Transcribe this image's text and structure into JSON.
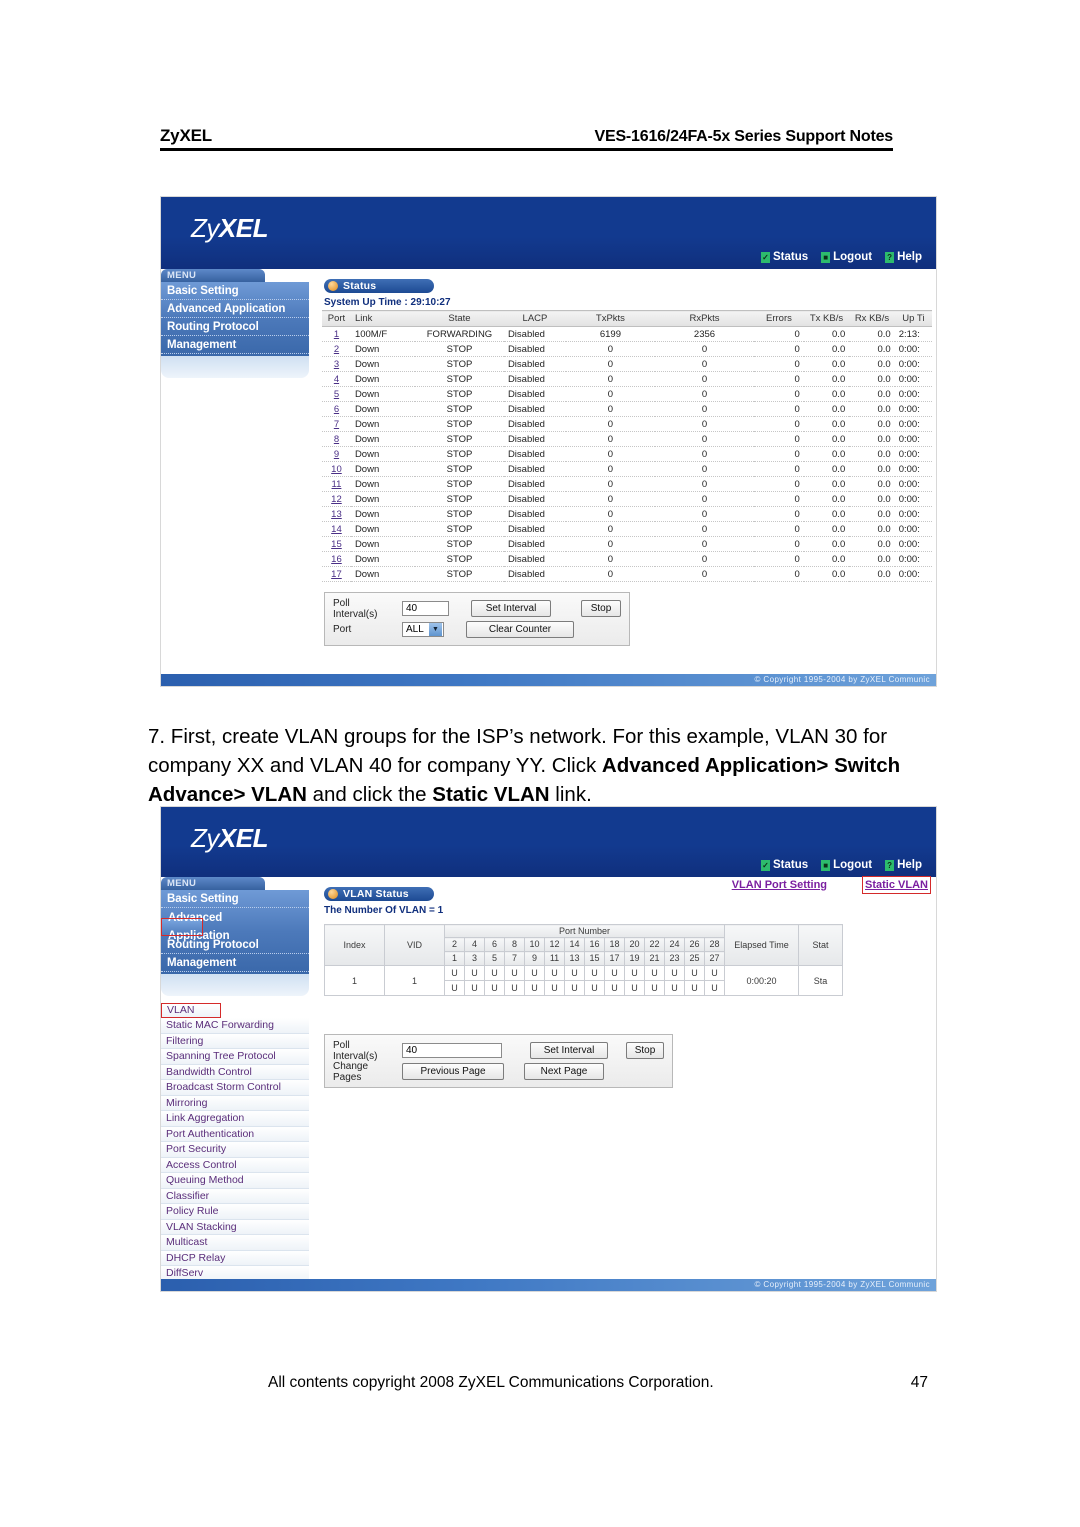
{
  "page": {
    "header": {
      "brand": "ZyXEL",
      "doc_title": "VES-1616/24FA-5x Series Support Notes"
    },
    "footer": {
      "copyright": "All contents copyright 2008 ZyXEL Communications Corporation.",
      "page_number": "47"
    },
    "instruction": {
      "part1": "7. First, create VLAN groups for the ISP’s network. For this example, VLAN 30 for company XX and VLAN 40 for company YY. Click ",
      "bold1": "Advanced Application> Switch Advance> VLAN",
      "part2": " and click the ",
      "bold2": "Static VLAN",
      "part3": " link."
    }
  },
  "device_ui": {
    "logo_prefix": "Zy",
    "logo_suffix": "XEL",
    "banner_links": [
      {
        "label": "Status",
        "glyph": "✓"
      },
      {
        "label": "Logout",
        "glyph": "■"
      },
      {
        "label": "Help",
        "glyph": "?"
      }
    ],
    "copyright_bar": "© Copyright 1995-2004 by ZyXEL Communic",
    "menu_tab_label": "MENU",
    "main_menu": [
      {
        "label": "Basic Setting",
        "selected": false
      },
      {
        "label": "Advanced Application",
        "selected": false
      },
      {
        "label": "Routing Protocol",
        "selected": false
      },
      {
        "label": "Management",
        "selected": false
      }
    ],
    "main_menu_2": [
      {
        "label": "Basic Setting",
        "selected": false
      },
      {
        "label": "Advanced Application",
        "selected": true
      },
      {
        "label": "Routing Protocol",
        "selected": false
      },
      {
        "label": "Management",
        "selected": false
      }
    ],
    "sub_menu": [
      {
        "label": "VLAN",
        "selected": true
      },
      {
        "label": "Static MAC Forwarding",
        "selected": false
      },
      {
        "label": "Filtering",
        "selected": false
      },
      {
        "label": "Spanning Tree Protocol",
        "selected": false
      },
      {
        "label": "Bandwidth Control",
        "selected": false
      },
      {
        "label": "Broadcast Storm Control",
        "selected": false
      },
      {
        "label": "Mirroring",
        "selected": false
      },
      {
        "label": "Link Aggregation",
        "selected": false
      },
      {
        "label": "Port Authentication",
        "selected": false
      },
      {
        "label": "Port Security",
        "selected": false
      },
      {
        "label": "Access Control",
        "selected": false
      },
      {
        "label": "Queuing Method",
        "selected": false
      },
      {
        "label": "Classifier",
        "selected": false
      },
      {
        "label": "Policy Rule",
        "selected": false
      },
      {
        "label": "VLAN Stacking",
        "selected": false
      },
      {
        "label": "Multicast",
        "selected": false
      },
      {
        "label": "DHCP Relay",
        "selected": false
      },
      {
        "label": "DiffServ",
        "selected": false
      }
    ]
  },
  "status_screen": {
    "panel_title": "Status",
    "system_up_time_label": "System Up Time : 29:10:27",
    "columns": [
      "Port",
      "Link",
      "State",
      "LACP",
      "TxPkts",
      "RxPkts",
      "Errors",
      "Tx KB/s",
      "Rx KB/s",
      "Up Ti"
    ],
    "rows": [
      {
        "port": "1",
        "link": "100M/F",
        "state": "FORWARDING",
        "lacp": "Disabled",
        "txpkts": "6199",
        "rxpkts": "2356",
        "errors": "0",
        "txkbs": "0.0",
        "rxkbs": "0.0",
        "uptime": "2:13:"
      },
      {
        "port": "2",
        "link": "Down",
        "state": "STOP",
        "lacp": "Disabled",
        "txpkts": "0",
        "rxpkts": "0",
        "errors": "0",
        "txkbs": "0.0",
        "rxkbs": "0.0",
        "uptime": "0:00:"
      },
      {
        "port": "3",
        "link": "Down",
        "state": "STOP",
        "lacp": "Disabled",
        "txpkts": "0",
        "rxpkts": "0",
        "errors": "0",
        "txkbs": "0.0",
        "rxkbs": "0.0",
        "uptime": "0:00:"
      },
      {
        "port": "4",
        "link": "Down",
        "state": "STOP",
        "lacp": "Disabled",
        "txpkts": "0",
        "rxpkts": "0",
        "errors": "0",
        "txkbs": "0.0",
        "rxkbs": "0.0",
        "uptime": "0:00:"
      },
      {
        "port": "5",
        "link": "Down",
        "state": "STOP",
        "lacp": "Disabled",
        "txpkts": "0",
        "rxpkts": "0",
        "errors": "0",
        "txkbs": "0.0",
        "rxkbs": "0.0",
        "uptime": "0:00:"
      },
      {
        "port": "6",
        "link": "Down",
        "state": "STOP",
        "lacp": "Disabled",
        "txpkts": "0",
        "rxpkts": "0",
        "errors": "0",
        "txkbs": "0.0",
        "rxkbs": "0.0",
        "uptime": "0:00:"
      },
      {
        "port": "7",
        "link": "Down",
        "state": "STOP",
        "lacp": "Disabled",
        "txpkts": "0",
        "rxpkts": "0",
        "errors": "0",
        "txkbs": "0.0",
        "rxkbs": "0.0",
        "uptime": "0:00:"
      },
      {
        "port": "8",
        "link": "Down",
        "state": "STOP",
        "lacp": "Disabled",
        "txpkts": "0",
        "rxpkts": "0",
        "errors": "0",
        "txkbs": "0.0",
        "rxkbs": "0.0",
        "uptime": "0:00:"
      },
      {
        "port": "9",
        "link": "Down",
        "state": "STOP",
        "lacp": "Disabled",
        "txpkts": "0",
        "rxpkts": "0",
        "errors": "0",
        "txkbs": "0.0",
        "rxkbs": "0.0",
        "uptime": "0:00:"
      },
      {
        "port": "10",
        "link": "Down",
        "state": "STOP",
        "lacp": "Disabled",
        "txpkts": "0",
        "rxpkts": "0",
        "errors": "0",
        "txkbs": "0.0",
        "rxkbs": "0.0",
        "uptime": "0:00:"
      },
      {
        "port": "11",
        "link": "Down",
        "state": "STOP",
        "lacp": "Disabled",
        "txpkts": "0",
        "rxpkts": "0",
        "errors": "0",
        "txkbs": "0.0",
        "rxkbs": "0.0",
        "uptime": "0:00:"
      },
      {
        "port": "12",
        "link": "Down",
        "state": "STOP",
        "lacp": "Disabled",
        "txpkts": "0",
        "rxpkts": "0",
        "errors": "0",
        "txkbs": "0.0",
        "rxkbs": "0.0",
        "uptime": "0:00:"
      },
      {
        "port": "13",
        "link": "Down",
        "state": "STOP",
        "lacp": "Disabled",
        "txpkts": "0",
        "rxpkts": "0",
        "errors": "0",
        "txkbs": "0.0",
        "rxkbs": "0.0",
        "uptime": "0:00:"
      },
      {
        "port": "14",
        "link": "Down",
        "state": "STOP",
        "lacp": "Disabled",
        "txpkts": "0",
        "rxpkts": "0",
        "errors": "0",
        "txkbs": "0.0",
        "rxkbs": "0.0",
        "uptime": "0:00:"
      },
      {
        "port": "15",
        "link": "Down",
        "state": "STOP",
        "lacp": "Disabled",
        "txpkts": "0",
        "rxpkts": "0",
        "errors": "0",
        "txkbs": "0.0",
        "rxkbs": "0.0",
        "uptime": "0:00:"
      },
      {
        "port": "16",
        "link": "Down",
        "state": "STOP",
        "lacp": "Disabled",
        "txpkts": "0",
        "rxpkts": "0",
        "errors": "0",
        "txkbs": "0.0",
        "rxkbs": "0.0",
        "uptime": "0:00:"
      },
      {
        "port": "17",
        "link": "Down",
        "state": "STOP",
        "lacp": "Disabled",
        "txpkts": "0",
        "rxpkts": "0",
        "errors": "0",
        "txkbs": "0.0",
        "rxkbs": "0.0",
        "uptime": "0:00:"
      }
    ],
    "controls": {
      "poll_interval_label": "Poll Interval(s)",
      "poll_interval_value": "40",
      "set_interval_button": "Set Interval",
      "stop_button": "Stop",
      "port_label": "Port",
      "port_value": "ALL",
      "clear_counter_button": "Clear Counter"
    }
  },
  "vlan_screen": {
    "panel_title": "VLAN Status",
    "vlan_count_label": "The Number Of VLAN = 1",
    "link_port_setting": "VLAN Port Setting",
    "link_static_vlan": "Static VLAN",
    "columns": {
      "index": "Index",
      "vid": "VID",
      "port_number": "Port Number",
      "elapsed_time": "Elapsed Time",
      "status": "Stat"
    },
    "port_header_top": [
      "2",
      "4",
      "6",
      "8",
      "10",
      "12",
      "14",
      "16",
      "18",
      "20",
      "22",
      "24",
      "26",
      "28"
    ],
    "port_header_bottom": [
      "1",
      "3",
      "5",
      "7",
      "9",
      "11",
      "13",
      "15",
      "17",
      "19",
      "21",
      "23",
      "25",
      "27"
    ],
    "rows": [
      {
        "index": "1",
        "vid": "1",
        "ports_top": [
          "U",
          "U",
          "U",
          "U",
          "U",
          "U",
          "U",
          "U",
          "U",
          "U",
          "U",
          "U",
          "U",
          "U"
        ],
        "ports_bottom": [
          "U",
          "U",
          "U",
          "U",
          "U",
          "U",
          "U",
          "U",
          "U",
          "U",
          "U",
          "U",
          "U",
          "U"
        ],
        "elapsed_time": "0:00:20",
        "status": "Sta"
      }
    ],
    "controls": {
      "poll_interval_label": "Poll Interval(s)",
      "poll_interval_value": "40",
      "set_interval_button": "Set Interval",
      "stop_button": "Stop",
      "change_pages_label": "Change Pages",
      "previous_page_button": "Previous Page",
      "next_page_button": "Next Page"
    }
  }
}
